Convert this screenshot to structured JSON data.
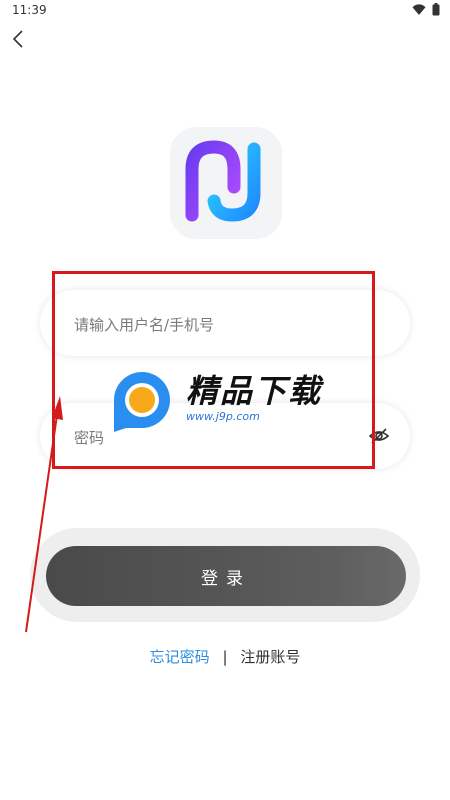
{
  "status_bar": {
    "time": "11:39",
    "icons": [
      "wifi-icon",
      "battery-icon"
    ]
  },
  "nav": {
    "back_icon": "chevron-left-icon"
  },
  "app_logo": {
    "icon": "app-logo-icon",
    "colors": [
      "#8a3ffc",
      "#3fb6ff"
    ]
  },
  "login_form": {
    "username_placeholder": "请输入用户名/手机号",
    "password_placeholder": "密码",
    "password_toggle_icon": "eye-off-icon",
    "submit_label": "登录"
  },
  "footer_links": {
    "forgot_password": "忘记密码",
    "separator": "|",
    "register": "注册账号"
  },
  "watermark": {
    "title": "精品下载",
    "url": "www.j9p.com"
  },
  "annotation": {
    "highlight_color": "#d41a1a"
  }
}
